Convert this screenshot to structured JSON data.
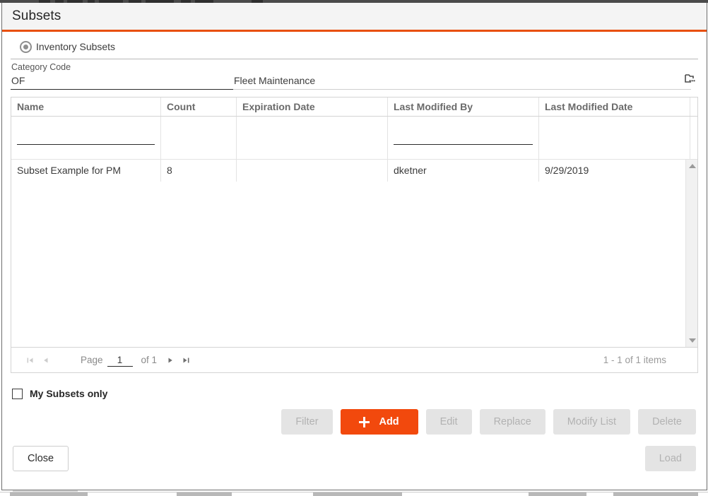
{
  "window": {
    "title": "Subsets",
    "accent_color": "#e8500f"
  },
  "scope": {
    "radio_label": "Inventory Subsets",
    "radio_selected": true
  },
  "category": {
    "caption": "Category Code",
    "code_value": "OF",
    "description_value": "Fleet Maintenance",
    "lookup_icon": "browse-lookup-icon"
  },
  "grid": {
    "columns": [
      {
        "key": "name",
        "label": "Name"
      },
      {
        "key": "count",
        "label": "Count"
      },
      {
        "key": "expiration_date",
        "label": "Expiration Date"
      },
      {
        "key": "last_modified_by",
        "label": "Last Modified By"
      },
      {
        "key": "last_modified_date",
        "label": "Last Modified Date"
      }
    ],
    "filters": {
      "name": "",
      "count": "",
      "expiration_date": "",
      "last_modified_by": "",
      "last_modified_date": ""
    },
    "rows": [
      {
        "name": "Subset Example for PM",
        "count": "8",
        "expiration_date": "",
        "last_modified_by": "dketner",
        "last_modified_date": "9/29/2019"
      }
    ],
    "scrollbar": {
      "up_icon": "triangle-up-icon",
      "down_icon": "triangle-down-icon"
    }
  },
  "pager": {
    "first_icon": "go-to-first-page-icon",
    "prev_icon": "go-to-previous-page-icon",
    "next_icon": "go-to-next-page-icon",
    "last_icon": "go-to-last-page-icon",
    "page_label": "Page",
    "page_value": "1",
    "of_label": "of 1",
    "items_label": "1 - 1 of 1 items"
  },
  "footer": {
    "my_subsets_label": "My Subsets only",
    "my_subsets_checked": false,
    "buttons": {
      "filter": {
        "label": "Filter",
        "enabled": false
      },
      "add": {
        "label": "Add",
        "enabled": true,
        "icon": "plus-icon",
        "color": "#f2490d"
      },
      "edit": {
        "label": "Edit",
        "enabled": false
      },
      "replace": {
        "label": "Replace",
        "enabled": false
      },
      "modify_list": {
        "label": "Modify List",
        "enabled": false
      },
      "delete": {
        "label": "Delete",
        "enabled": false
      },
      "close": {
        "label": "Close",
        "enabled": true
      },
      "load": {
        "label": "Load",
        "enabled": false
      }
    }
  }
}
